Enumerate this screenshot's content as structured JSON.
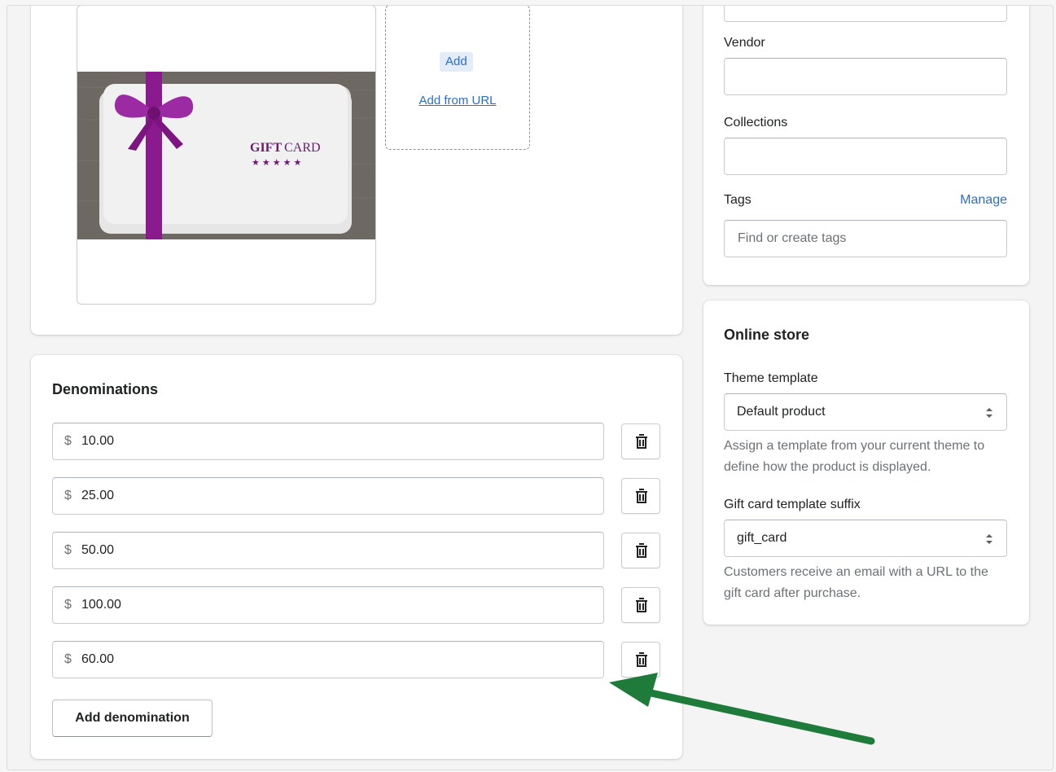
{
  "media": {
    "image_title": "GIFT CARD",
    "image_title_bold": "GIFT",
    "image_title_rest": "CARD",
    "image_stars": "★★★★★",
    "add_label": "Add",
    "add_from_url_label": "Add from URL"
  },
  "denominations": {
    "heading": "Denominations",
    "currency": "$",
    "items": [
      {
        "amount": "10.00"
      },
      {
        "amount": "25.00"
      },
      {
        "amount": "50.00"
      },
      {
        "amount": "100.00"
      },
      {
        "amount": "60.00"
      }
    ],
    "delete_icon": "trash-icon",
    "add_button_label": "Add denomination"
  },
  "organization": {
    "vendor_label": "Vendor",
    "vendor_value": "",
    "collections_label": "Collections",
    "collections_value": "",
    "tags_label": "Tags",
    "tags_manage_label": "Manage",
    "tags_placeholder": "Find or create tags"
  },
  "online_store": {
    "heading": "Online store",
    "theme_template_label": "Theme template",
    "theme_template_value": "Default product",
    "theme_template_help": "Assign a template from your current theme to define how the product is displayed.",
    "gift_card_suffix_label": "Gift card template suffix",
    "gift_card_suffix_value": "gift_card",
    "gift_card_suffix_help": "Customers receive an email with a URL to the gift card after purchase."
  },
  "annotation": {
    "arrow_color": "#1e7b3a"
  },
  "colors": {
    "link": "#2c6ecb",
    "ribbon": "#8b1a8f",
    "card_title": "#6a1b6f"
  }
}
